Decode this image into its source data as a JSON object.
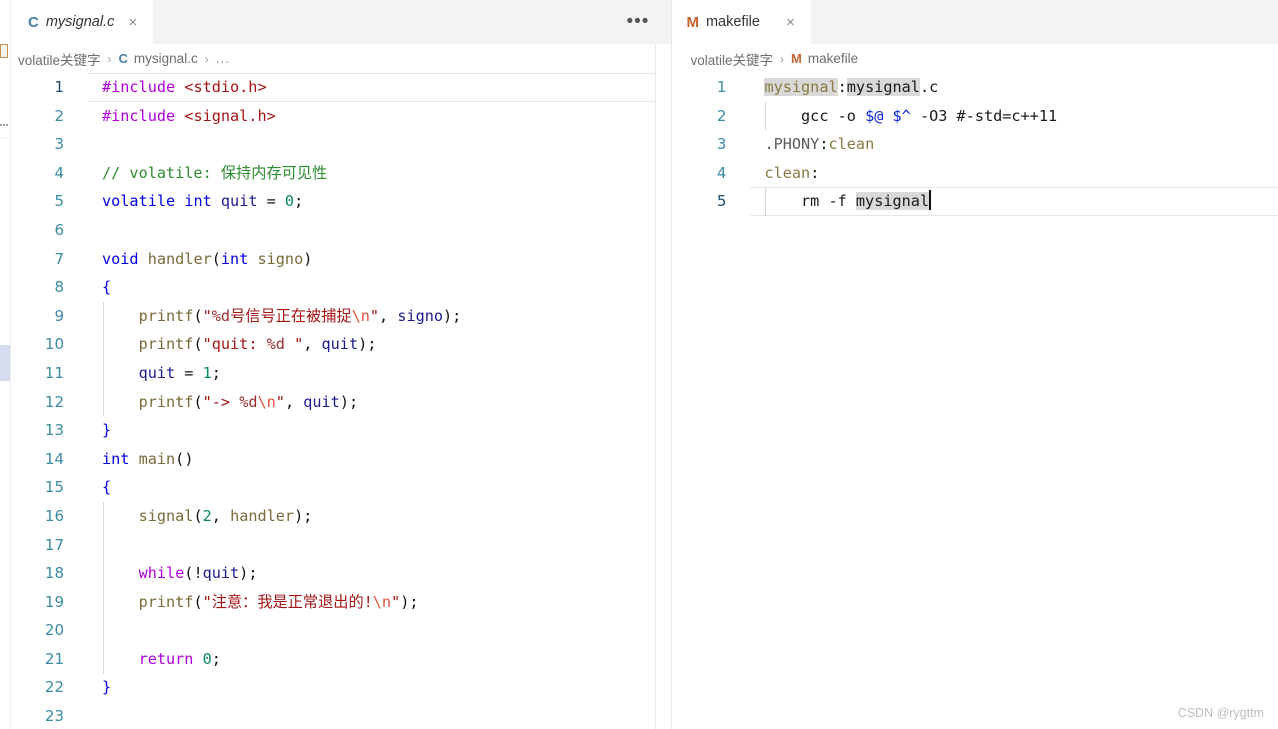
{
  "window": {
    "watermark": "CSDN @rygttm"
  },
  "left_pane": {
    "tab": {
      "icon": "c-file-icon",
      "icon_letter": "C",
      "label": "mysignal.c",
      "close": "×"
    },
    "overflow_button": "•••",
    "breadcrumb": {
      "items": [
        "volatile关键字",
        "mysignal.c"
      ],
      "icon_letter": "C",
      "separator": "›",
      "more": "..."
    },
    "active_line": 1,
    "lines": [
      {
        "n": 1,
        "tokens": [
          {
            "t": "#include ",
            "c": "t-pre"
          },
          {
            "t": "<stdio.h>",
            "c": "t-inc"
          }
        ]
      },
      {
        "n": 2,
        "tokens": [
          {
            "t": "#include ",
            "c": "t-pre"
          },
          {
            "t": "<signal.h>",
            "c": "t-inc"
          }
        ]
      },
      {
        "n": 3,
        "tokens": []
      },
      {
        "n": 4,
        "tokens": [
          {
            "t": "// volatile: 保持内存可见性",
            "c": "t-cmt"
          }
        ]
      },
      {
        "n": 5,
        "tokens": [
          {
            "t": "volatile",
            "c": "t-key"
          },
          {
            "t": " ",
            "c": "t-plain"
          },
          {
            "t": "int",
            "c": "t-key"
          },
          {
            "t": " ",
            "c": "t-plain"
          },
          {
            "t": "quit",
            "c": "t-var"
          },
          {
            "t": " = ",
            "c": "t-op"
          },
          {
            "t": "0",
            "c": "t-num"
          },
          {
            "t": ";",
            "c": "t-punc"
          }
        ]
      },
      {
        "n": 6,
        "tokens": []
      },
      {
        "n": 7,
        "tokens": [
          {
            "t": "void",
            "c": "t-key"
          },
          {
            "t": " ",
            "c": "t-plain"
          },
          {
            "t": "handler",
            "c": "t-fn"
          },
          {
            "t": "(",
            "c": "t-punc"
          },
          {
            "t": "int",
            "c": "t-key"
          },
          {
            "t": " ",
            "c": "t-plain"
          },
          {
            "t": "signo",
            "c": "t-fn"
          },
          {
            "t": ")",
            "c": "t-punc"
          }
        ]
      },
      {
        "n": 8,
        "tokens": [
          {
            "t": "{",
            "c": "t-key"
          }
        ]
      },
      {
        "n": 9,
        "tokens": [
          {
            "t": "    ",
            "c": "t-plain"
          },
          {
            "t": "printf",
            "c": "t-fn"
          },
          {
            "t": "(",
            "c": "t-punc"
          },
          {
            "t": "\"",
            "c": "t-str"
          },
          {
            "t": "%d",
            "c": "t-pct"
          },
          {
            "t": "号信号正在被捕捉",
            "c": "t-str"
          },
          {
            "t": "\\n",
            "c": "t-esc"
          },
          {
            "t": "\"",
            "c": "t-str"
          },
          {
            "t": ", ",
            "c": "t-punc"
          },
          {
            "t": "signo",
            "c": "t-var"
          },
          {
            "t": ");",
            "c": "t-punc"
          }
        ]
      },
      {
        "n": 10,
        "tokens": [
          {
            "t": "    ",
            "c": "t-plain"
          },
          {
            "t": "printf",
            "c": "t-fn"
          },
          {
            "t": "(",
            "c": "t-punc"
          },
          {
            "t": "\"quit: ",
            "c": "t-str"
          },
          {
            "t": "%d",
            "c": "t-pct"
          },
          {
            "t": " \"",
            "c": "t-str"
          },
          {
            "t": ", ",
            "c": "t-punc"
          },
          {
            "t": "quit",
            "c": "t-var"
          },
          {
            "t": ");",
            "c": "t-punc"
          }
        ]
      },
      {
        "n": 11,
        "tokens": [
          {
            "t": "    ",
            "c": "t-plain"
          },
          {
            "t": "quit",
            "c": "t-var"
          },
          {
            "t": " = ",
            "c": "t-op"
          },
          {
            "t": "1",
            "c": "t-num"
          },
          {
            "t": ";",
            "c": "t-punc"
          }
        ]
      },
      {
        "n": 12,
        "tokens": [
          {
            "t": "    ",
            "c": "t-plain"
          },
          {
            "t": "printf",
            "c": "t-fn"
          },
          {
            "t": "(",
            "c": "t-punc"
          },
          {
            "t": "\"-> ",
            "c": "t-str"
          },
          {
            "t": "%d",
            "c": "t-pct"
          },
          {
            "t": "\\n",
            "c": "t-esc"
          },
          {
            "t": "\"",
            "c": "t-str"
          },
          {
            "t": ", ",
            "c": "t-punc"
          },
          {
            "t": "quit",
            "c": "t-var"
          },
          {
            "t": ");",
            "c": "t-punc"
          }
        ]
      },
      {
        "n": 13,
        "tokens": [
          {
            "t": "}",
            "c": "t-key"
          }
        ]
      },
      {
        "n": 14,
        "tokens": [
          {
            "t": "int",
            "c": "t-key"
          },
          {
            "t": " ",
            "c": "t-plain"
          },
          {
            "t": "main",
            "c": "t-fn"
          },
          {
            "t": "()",
            "c": "t-punc"
          }
        ]
      },
      {
        "n": 15,
        "tokens": [
          {
            "t": "{",
            "c": "t-key"
          }
        ]
      },
      {
        "n": 16,
        "tokens": [
          {
            "t": "    ",
            "c": "t-plain"
          },
          {
            "t": "signal",
            "c": "t-fn"
          },
          {
            "t": "(",
            "c": "t-punc"
          },
          {
            "t": "2",
            "c": "t-num"
          },
          {
            "t": ", ",
            "c": "t-punc"
          },
          {
            "t": "handler",
            "c": "t-fn"
          },
          {
            "t": ");",
            "c": "t-punc"
          }
        ]
      },
      {
        "n": 17,
        "tokens": []
      },
      {
        "n": 18,
        "tokens": [
          {
            "t": "    ",
            "c": "t-plain"
          },
          {
            "t": "while",
            "c": "t-ctl"
          },
          {
            "t": "(!",
            "c": "t-punc"
          },
          {
            "t": "quit",
            "c": "t-var"
          },
          {
            "t": ");",
            "c": "t-punc"
          }
        ]
      },
      {
        "n": 19,
        "tokens": [
          {
            "t": "    ",
            "c": "t-plain"
          },
          {
            "t": "printf",
            "c": "t-fn"
          },
          {
            "t": "(",
            "c": "t-punc"
          },
          {
            "t": "\"注意：我是正常退出的!",
            "c": "t-str"
          },
          {
            "t": "\\n",
            "c": "t-esc"
          },
          {
            "t": "\"",
            "c": "t-str"
          },
          {
            "t": ");",
            "c": "t-punc"
          }
        ]
      },
      {
        "n": 20,
        "tokens": []
      },
      {
        "n": 21,
        "tokens": [
          {
            "t": "    ",
            "c": "t-plain"
          },
          {
            "t": "return",
            "c": "t-ctl"
          },
          {
            "t": " ",
            "c": "t-plain"
          },
          {
            "t": "0",
            "c": "t-num"
          },
          {
            "t": ";",
            "c": "t-punc"
          }
        ]
      },
      {
        "n": 22,
        "tokens": [
          {
            "t": "}",
            "c": "t-key"
          }
        ]
      },
      {
        "n": 23,
        "tokens": []
      }
    ]
  },
  "right_pane": {
    "tab": {
      "icon": "makefile-icon",
      "icon_letter": "M",
      "label": "makefile",
      "close": "×"
    },
    "breadcrumb": {
      "items": [
        "volatile关键字",
        "makefile"
      ],
      "icon_letter": "M",
      "separator": "›"
    },
    "active_line": 5,
    "lines": [
      {
        "n": 1,
        "tokens": [
          {
            "t": "mysignal",
            "c": "t-mk-tgt",
            "hl": true
          },
          {
            "t": ":",
            "c": "t-mk-plain"
          },
          {
            "t": "mysignal",
            "c": "t-mk-plain",
            "hl": true
          },
          {
            "t": ".c",
            "c": "t-mk-plain"
          }
        ]
      },
      {
        "n": 2,
        "tokens": [
          {
            "t": "    gcc -o ",
            "c": "t-mk-cmd"
          },
          {
            "t": "$@",
            "c": "t-mk-var"
          },
          {
            "t": " ",
            "c": "t-mk-cmd"
          },
          {
            "t": "$^",
            "c": "t-mk-var"
          },
          {
            "t": " -O3 #-std=c++11",
            "c": "t-mk-cmd"
          }
        ]
      },
      {
        "n": 3,
        "tokens": [
          {
            "t": ".PHONY",
            "c": "t-mk-ph"
          },
          {
            "t": ":",
            "c": "t-mk-plain"
          },
          {
            "t": "clean",
            "c": "t-mk-tan"
          }
        ]
      },
      {
        "n": 4,
        "tokens": [
          {
            "t": "clean",
            "c": "t-mk-tan"
          },
          {
            "t": ":",
            "c": "t-mk-plain"
          }
        ]
      },
      {
        "n": 5,
        "tokens": [
          {
            "t": "    rm -f ",
            "c": "t-mk-cmd"
          },
          {
            "t": "mysignal",
            "c": "t-mk-cmd",
            "hl": true
          },
          {
            "t": "",
            "c": "caret"
          }
        ]
      }
    ]
  }
}
